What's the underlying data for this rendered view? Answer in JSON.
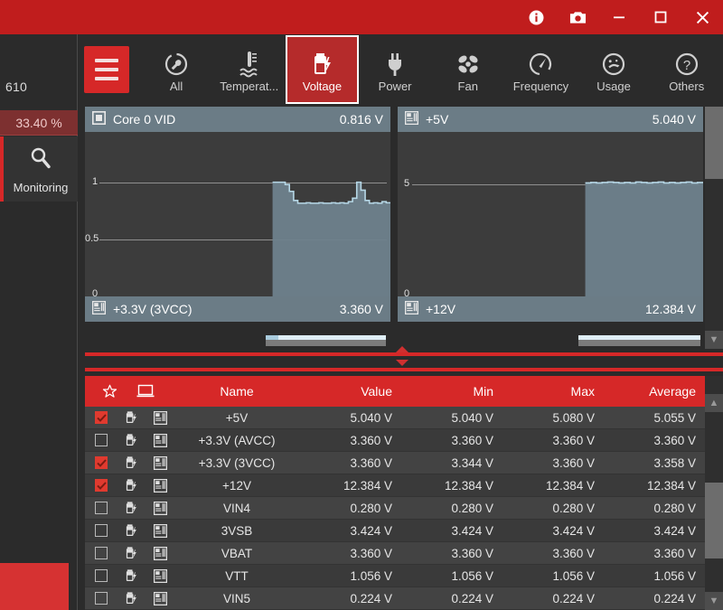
{
  "window": {
    "titlebar_color": "#c01d1d",
    "buttons": [
      {
        "name": "info-icon",
        "label": "Info"
      },
      {
        "name": "screenshot-icon",
        "label": "Screenshot"
      },
      {
        "name": "minimize-button",
        "label": "Minimize"
      },
      {
        "name": "maximize-button",
        "label": "Maximize"
      },
      {
        "name": "close-button",
        "label": "Close"
      }
    ]
  },
  "sidebar": {
    "number": "610",
    "badge": "33.40 %",
    "items": [
      {
        "label": "Monitoring",
        "icon": "magnifier-icon",
        "selected": true
      }
    ]
  },
  "toolbar": {
    "menu_label": "Menu",
    "tabs": [
      {
        "label": "All",
        "icon": "wrench-gauge-icon",
        "active": false
      },
      {
        "label": "Temperat...",
        "icon": "thermometer-icon",
        "active": false
      },
      {
        "label": "Voltage",
        "icon": "battery-bolt-icon",
        "active": true
      },
      {
        "label": "Power",
        "icon": "power-plug-icon",
        "active": false
      },
      {
        "label": "Fan",
        "icon": "fan-icon",
        "active": false
      },
      {
        "label": "Frequency",
        "icon": "speedometer-icon",
        "active": false
      },
      {
        "label": "Usage",
        "icon": "gauge-icon",
        "active": false
      },
      {
        "label": "Others",
        "icon": "question-icon",
        "active": false
      }
    ]
  },
  "graphs": [
    {
      "header": {
        "icon": "cpu-icon",
        "name": "Core 0 VID",
        "value": "0.816 V"
      },
      "footer": {
        "icon": "motherboard-icon",
        "name": "+3.3V (3VCC)",
        "value": "3.360 V"
      },
      "y_ticks": [
        "1",
        "0.5",
        "0"
      ]
    },
    {
      "header": {
        "icon": "motherboard-icon",
        "name": "+5V",
        "value": "5.040 V"
      },
      "footer": {
        "icon": "motherboard-icon",
        "name": "+12V",
        "value": "12.384 V"
      },
      "y_ticks": [
        "5",
        "0"
      ]
    }
  ],
  "chart_data": [
    {
      "type": "area",
      "title": "Core 0 VID",
      "ylabel": "V",
      "ylim": [
        0,
        1.1
      ],
      "yticks": [
        0,
        0.5,
        1
      ],
      "grid": true,
      "series": [
        {
          "name": "Core 0 VID",
          "line_color": "#b6d7e6",
          "fill_color": "#6e818c",
          "values": [
            1.0,
            1.0,
            1.0,
            0.98,
            0.92,
            0.84,
            0.816,
            0.816,
            0.82,
            0.816,
            0.816,
            0.82,
            0.816,
            0.816,
            0.82,
            0.816,
            0.82,
            0.816,
            0.83,
            0.86,
            1.0,
            0.93,
            0.84,
            0.816,
            0.82,
            0.816,
            0.83,
            0.82,
            0.82
          ]
        }
      ]
    },
    {
      "type": "area",
      "title": "+5V",
      "ylabel": "V",
      "ylim": [
        0,
        5.5
      ],
      "yticks": [
        0,
        5
      ],
      "grid": true,
      "series": [
        {
          "name": "+5V",
          "line_color": "#b6d7e6",
          "fill_color": "#6e818c",
          "values": [
            5.04,
            5.06,
            5.04,
            5.06,
            5.08,
            5.06,
            5.04,
            5.06,
            5.04,
            5.08,
            5.06,
            5.04,
            5.06,
            5.08,
            5.04,
            5.06,
            5.04,
            5.06,
            5.08,
            5.04,
            5.06,
            5.04
          ]
        }
      ]
    }
  ],
  "table": {
    "columns": [
      {
        "label": "",
        "icon": "star-icon"
      },
      {
        "label": "",
        "icon": "monitor-icon"
      },
      {
        "label": "Name"
      },
      {
        "label": "Value"
      },
      {
        "label": "Min"
      },
      {
        "label": "Max"
      },
      {
        "label": "Average"
      }
    ],
    "rows": [
      {
        "checked": true,
        "icon1": "battery-bolt-icon",
        "icon2": "motherboard-icon",
        "name": "+5V",
        "value": "5.040 V",
        "min": "5.040 V",
        "max": "5.080 V",
        "average": "5.055 V"
      },
      {
        "checked": false,
        "icon1": "battery-bolt-icon",
        "icon2": "motherboard-icon",
        "name": "+3.3V (AVCC)",
        "value": "3.360 V",
        "min": "3.360 V",
        "max": "3.360 V",
        "average": "3.360 V"
      },
      {
        "checked": true,
        "icon1": "battery-bolt-icon",
        "icon2": "motherboard-icon",
        "name": "+3.3V (3VCC)",
        "value": "3.360 V",
        "min": "3.344 V",
        "max": "3.360 V",
        "average": "3.358 V"
      },
      {
        "checked": true,
        "icon1": "battery-bolt-icon",
        "icon2": "motherboard-icon",
        "name": "+12V",
        "value": "12.384 V",
        "min": "12.384 V",
        "max": "12.384 V",
        "average": "12.384 V"
      },
      {
        "checked": false,
        "icon1": "battery-bolt-icon",
        "icon2": "motherboard-icon",
        "name": "VIN4",
        "value": "0.280 V",
        "min": "0.280 V",
        "max": "0.280 V",
        "average": "0.280 V"
      },
      {
        "checked": false,
        "icon1": "battery-bolt-icon",
        "icon2": "motherboard-icon",
        "name": "3VSB",
        "value": "3.424 V",
        "min": "3.424 V",
        "max": "3.424 V",
        "average": "3.424 V"
      },
      {
        "checked": false,
        "icon1": "battery-bolt-icon",
        "icon2": "motherboard-icon",
        "name": "VBAT",
        "value": "3.360 V",
        "min": "3.360 V",
        "max": "3.360 V",
        "average": "3.360 V"
      },
      {
        "checked": false,
        "icon1": "battery-bolt-icon",
        "icon2": "motherboard-icon",
        "name": "VTT",
        "value": "1.056 V",
        "min": "1.056 V",
        "max": "1.056 V",
        "average": "1.056 V"
      },
      {
        "checked": false,
        "icon1": "battery-bolt-icon",
        "icon2": "motherboard-icon",
        "name": "VIN5",
        "value": "0.224 V",
        "min": "0.224 V",
        "max": "0.224 V",
        "average": "0.224 V"
      }
    ]
  },
  "colors": {
    "accent": "#d62828",
    "title_bar": "#c01d1d",
    "panel_header": "#6b7c86",
    "graph_line": "#b6d7e6",
    "graph_fill": "#6e818c"
  }
}
